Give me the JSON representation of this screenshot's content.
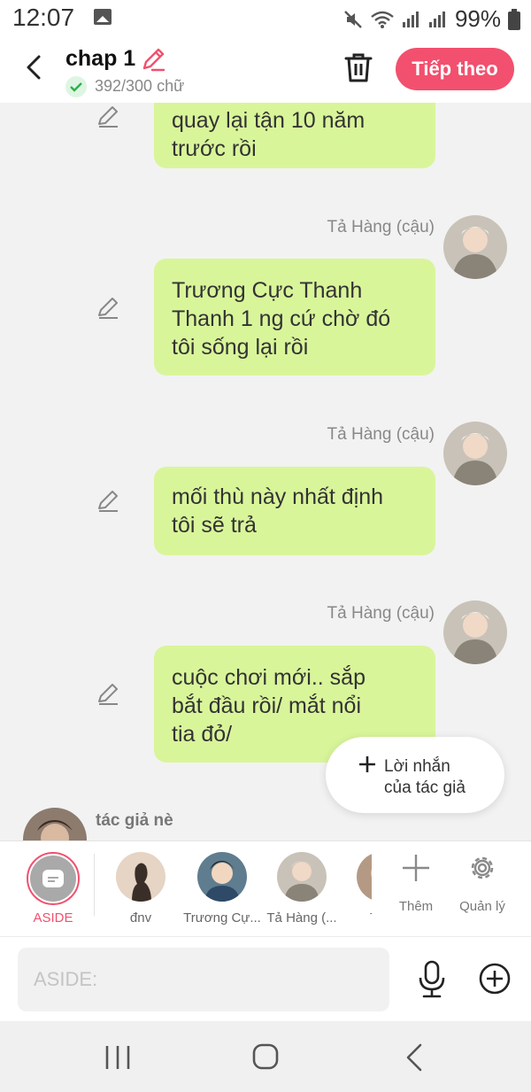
{
  "status_bar": {
    "time": "12:07",
    "battery": "99%"
  },
  "header": {
    "title": "chap 1",
    "word_count": "392/300 chữ",
    "next_label": "Tiếp theo"
  },
  "messages": [
    {
      "text_lines": [
        "quay lại tận 10 năm",
        "trước rồi"
      ]
    },
    {
      "sender": "Tả Hàng (cậu)",
      "text_lines": [
        "Trương Cực Thanh",
        "Thanh 1 ng cứ chờ đó",
        "tôi sống lại rồi"
      ]
    },
    {
      "sender": "Tả Hàng (cậu)",
      "text_lines": [
        "mối thù này nhất định",
        "tôi sẽ trả"
      ]
    },
    {
      "sender": "Tả Hàng (cậu)",
      "text_lines": [
        "cuộc chơi mới.. sắp",
        "bắt đầu rồi/ mắt nổi",
        "tia đỏ/"
      ]
    }
  ],
  "author_message": {
    "line1": "Lời nhắn",
    "line2": "của tác giả"
  },
  "author": {
    "label": "tác giả nè"
  },
  "characters": {
    "aside_label": "ASIDE",
    "items": [
      {
        "label": "đnv"
      },
      {
        "label": "Trương Cự..."
      },
      {
        "label": "Tả Hàng (..."
      },
      {
        "label": "Tha"
      }
    ],
    "add_label": "Thêm",
    "manage_label": "Quản lý"
  },
  "input": {
    "placeholder": "ASIDE:"
  },
  "colors": {
    "accent": "#f2506e",
    "bubble": "#d9f59a",
    "background": "#f2f2f2"
  }
}
